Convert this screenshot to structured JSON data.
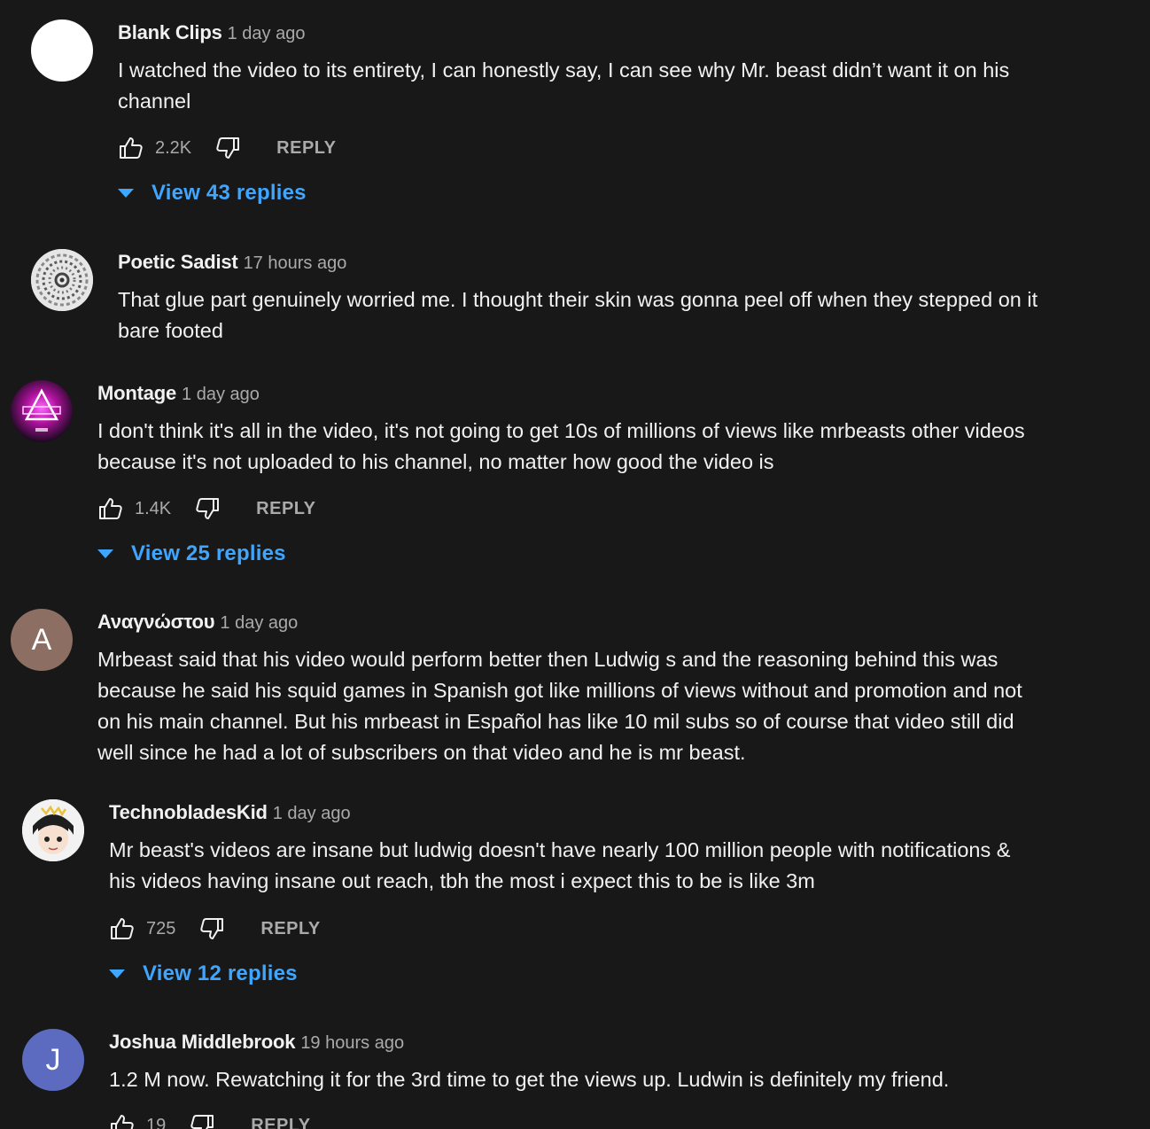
{
  "comments": [
    {
      "author": "Blank Clips",
      "time": "1 day ago",
      "text_lines": [
        "I watched the video to its entirety, I can honestly say, I can see why Mr. beast didn’t want it on his",
        "channel"
      ],
      "likes": "2.2K",
      "reply_label": "REPLY",
      "view_replies": "View 43 replies",
      "avatar": {
        "type": "blank",
        "color": "#ffffff"
      }
    },
    {
      "author": "Poetic Sadist",
      "time": "17 hours ago",
      "text_lines": [
        "That glue part genuinely worried me. I thought their skin was gonna peel off when they stepped on it",
        "bare footed"
      ],
      "avatar": {
        "type": "image",
        "icon": "swirl-pattern-avatar"
      }
    },
    {
      "author": "Montage",
      "time": "1 day ago",
      "text_lines": [
        "I don't think it's all in the video, it's not going to get 10s of millions of views like mrbeasts other videos",
        "because it's not uploaded to his channel, no matter how good the video is"
      ],
      "likes": "1.4K",
      "reply_label": "REPLY",
      "view_replies": "View 25 replies",
      "avatar": {
        "type": "image",
        "icon": "neon-logo-avatar"
      }
    },
    {
      "author": "Αναγνώστου",
      "time": "1 day ago",
      "text_lines": [
        "Mrbeast said that his video would perform better then Ludwig s and the reasoning behind this was",
        "because he said his squid games in Spanish got like millions of views without and promotion and not",
        "on his main channel. But his mrbeast in Español has like 10 mil subs so of course that video still did",
        "well since he had a lot of subscribers on that video and he is mr beast."
      ],
      "avatar": {
        "type": "letter",
        "letter": "A",
        "color": "#8d6e63"
      }
    },
    {
      "author": "TechnobladesKid",
      "time": "1 day ago",
      "text_lines": [
        "Mr beast's videos are insane but ludwig doesn't have nearly 100 million people with notifications &",
        "his videos having insane out reach, tbh the most i expect this to be is like 3m"
      ],
      "likes": "725",
      "reply_label": "REPLY",
      "view_replies": "View 12 replies",
      "avatar": {
        "type": "image",
        "icon": "anime-character-avatar"
      }
    },
    {
      "author": "Joshua Middlebrook",
      "time": "19 hours ago",
      "text_lines": [
        "1.2 M now. Rewatching it for the 3rd time to get the views up. Ludwin is definitely my friend."
      ],
      "likes": "19",
      "reply_label": "REPLY",
      "avatar": {
        "type": "letter",
        "letter": "J",
        "color": "#5c6bc0"
      }
    }
  ]
}
